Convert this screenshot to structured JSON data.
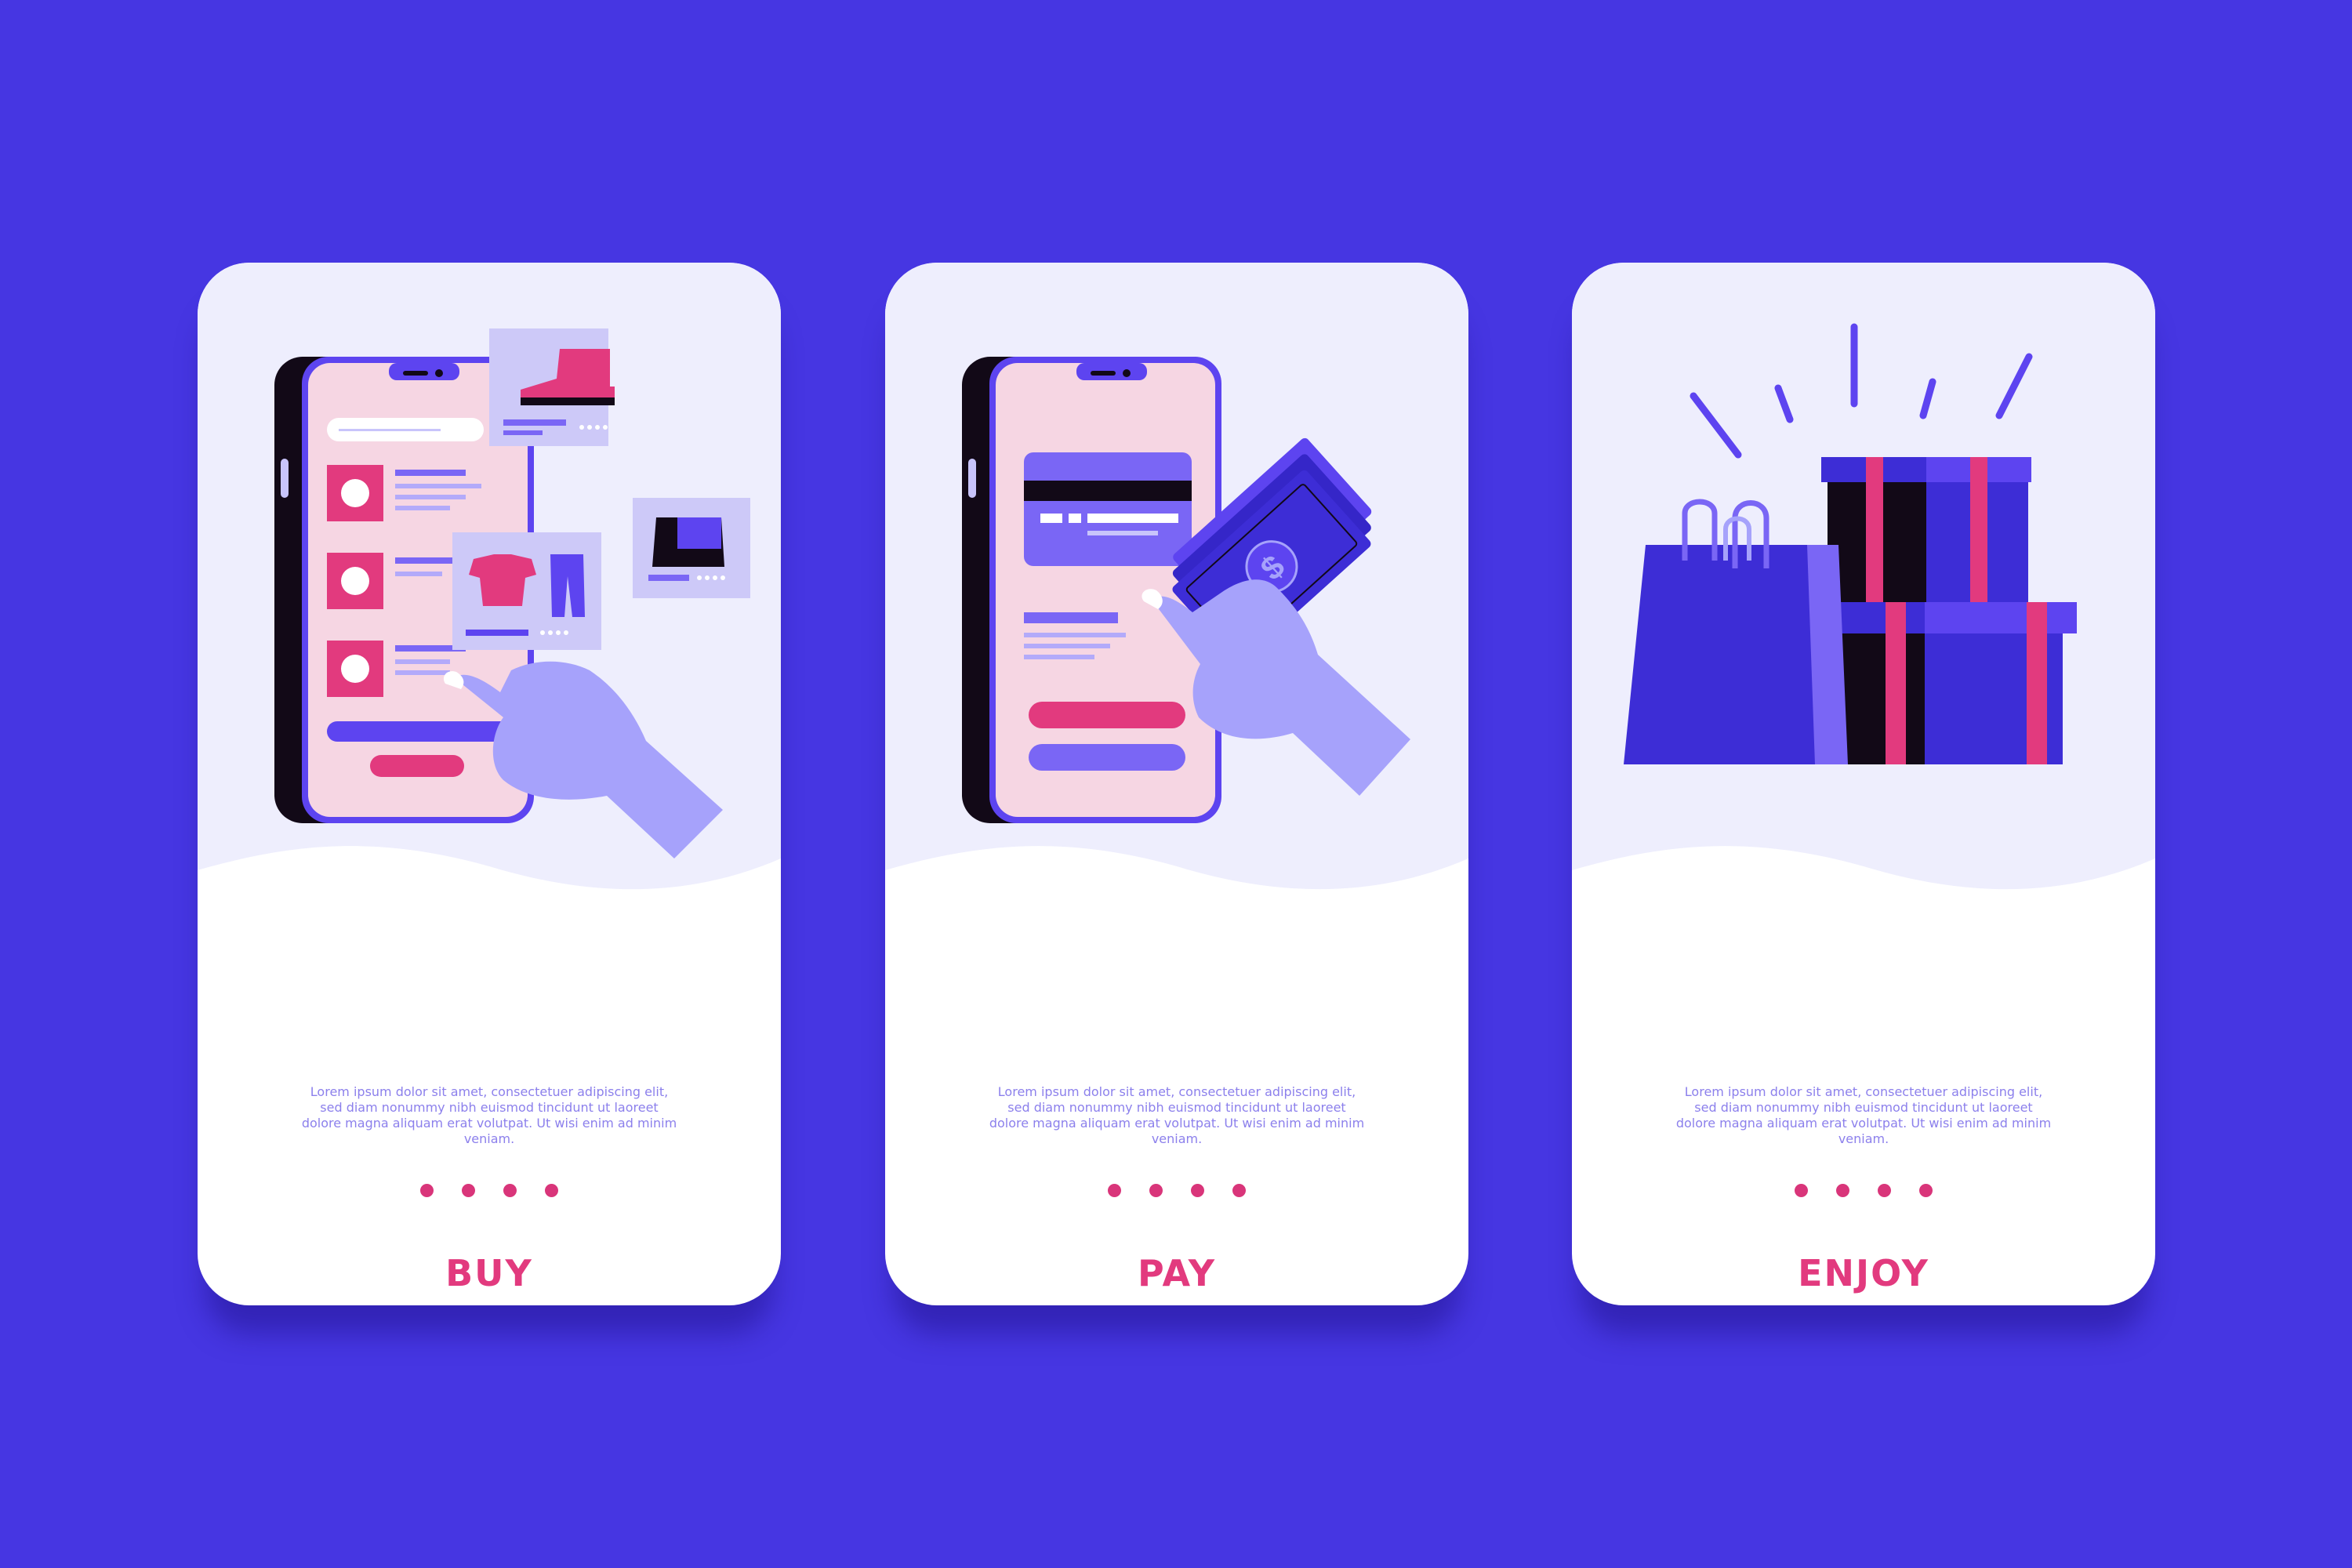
{
  "colors": {
    "background": "#4636e2",
    "card": "#ffffff",
    "card_top": "#eeeefd",
    "accent_pink": "#e23a7e",
    "body_text": "#8c80ec",
    "phone_screen": "#f5d4e0",
    "hand": "#a6a2fb",
    "dark": "#120917"
  },
  "cards": [
    {
      "title": "BUY",
      "illustration": "phone-shop-icon",
      "body": "Lorem ipsum dolor sit amet, consectetuer adipiscing elit, sed diam nonummy nibh euismod tincidunt ut laoreet dolore magna aliquam erat volutpat. Ut wisi enim ad minim veniam.",
      "dots": 4
    },
    {
      "title": "PAY",
      "illustration": "phone-pay-icon",
      "body": "Lorem ipsum dolor sit amet, consectetuer adipiscing elit, sed diam nonummy nibh euismod tincidunt ut laoreet dolore magna aliquam erat volutpat. Ut wisi enim ad minim veniam.",
      "dots": 4
    },
    {
      "title": "ENJOY",
      "illustration": "gifts-bags-icon",
      "body": "Lorem ipsum dolor sit amet, consectetuer adipiscing elit, sed diam nonummy nibh euismod tincidunt ut laoreet dolore magna aliquam erat volutpat. Ut wisi enim ad minim veniam.",
      "dots": 4
    }
  ]
}
